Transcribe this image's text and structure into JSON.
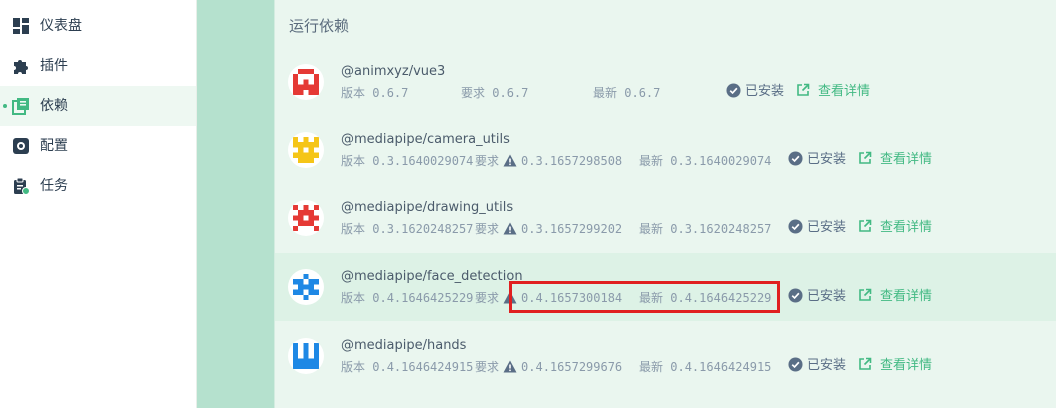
{
  "sidebar": {
    "items": [
      {
        "label": "仪表盘",
        "icon": "dashboard-icon"
      },
      {
        "label": "插件",
        "icon": "puzzle-icon"
      },
      {
        "label": "依赖",
        "icon": "library-icon",
        "active": true
      },
      {
        "label": "配置",
        "icon": "gear-icon"
      },
      {
        "label": "任务",
        "icon": "clipboard-icon"
      }
    ]
  },
  "panel": {
    "title": "运行依赖"
  },
  "labels": {
    "version": "版本",
    "required": "要求",
    "latest": "最新",
    "installed": "已安装",
    "details": "查看详情"
  },
  "deps": [
    {
      "name": "@animxyz/vue3",
      "version": "0.6.7",
      "required": "0.6.7",
      "latest": "0.6.7",
      "warn": false,
      "icon_color": "#e53935"
    },
    {
      "name": "@mediapipe/camera_utils",
      "version": "0.3.1640029074",
      "required": "0.3.1657298508",
      "latest": "0.3.1640029074",
      "warn": true,
      "icon_color": "#f5c518"
    },
    {
      "name": "@mediapipe/drawing_utils",
      "version": "0.3.1620248257",
      "required": "0.3.1657299202",
      "latest": "0.3.1620248257",
      "warn": true,
      "icon_color": "#e53935"
    },
    {
      "name": "@mediapipe/face_detection",
      "version": "0.4.1646425229",
      "required": "0.4.1657300184",
      "latest": "0.4.1646425229",
      "warn": true,
      "icon_color": "#1e88e5"
    },
    {
      "name": "@mediapipe/hands",
      "version": "0.4.1646424915",
      "required": "0.4.1657299676",
      "latest": "0.4.1646424915",
      "warn": true,
      "icon_color": "#1e88e5"
    }
  ],
  "colors": {
    "accent": "#42b983",
    "highlight_box": "#e02020",
    "content_bg": "#b5e1ce",
    "panel_bg": "#eaf6ef"
  }
}
